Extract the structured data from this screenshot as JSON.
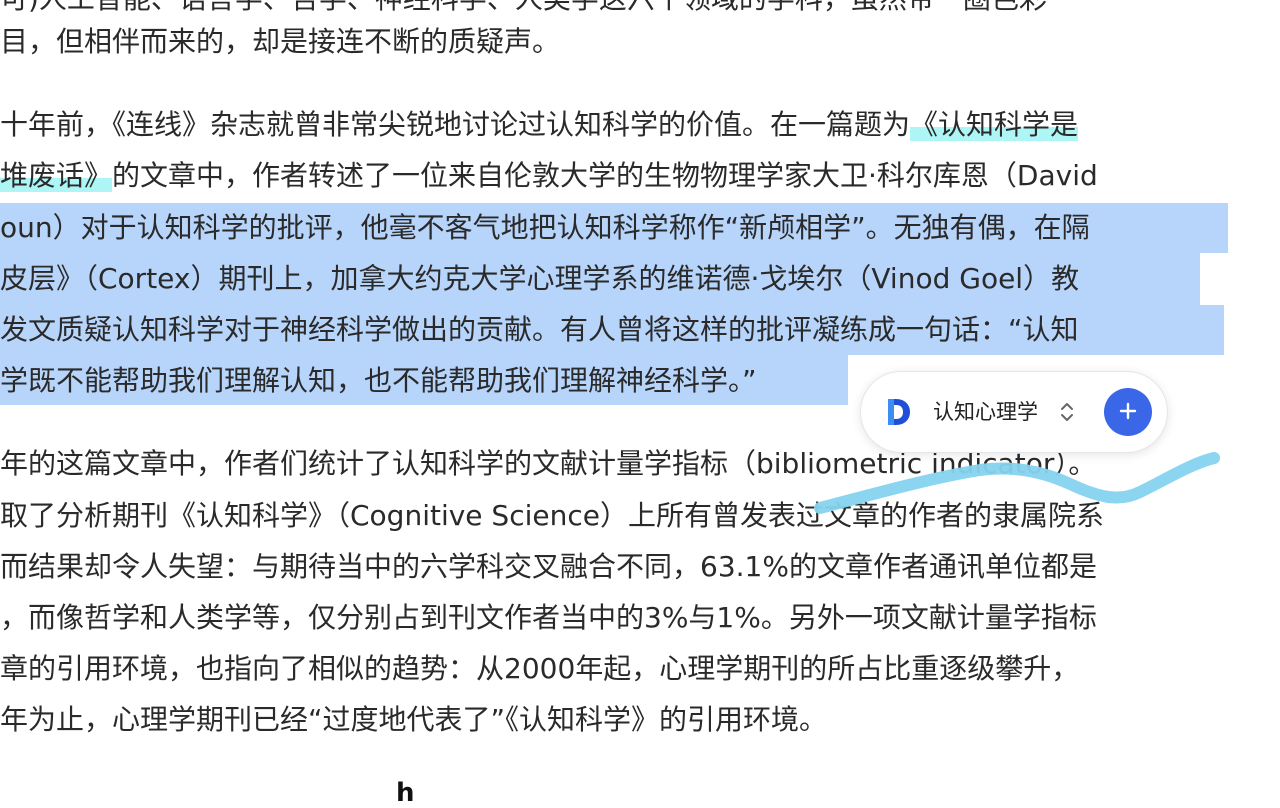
{
  "article": {
    "lines": [
      {
        "parts": [
          {
            "text": "可)人工智能、语言学、哲学、神经科学、人类学这六个领域的学科，虽然带一圈色彩",
            "style": "plain"
          }
        ]
      },
      {
        "parts": [
          {
            "text": "目，但相伴而来的，却是接连不断的质疑声。",
            "style": "plain"
          }
        ]
      },
      {
        "parts": [
          {
            "text": "十年前，《连线》杂志就曾非常尖锐地讨论过认知科学的价值。在一篇题为",
            "style": "plain"
          },
          {
            "text": "《认知科学是",
            "style": "teal"
          }
        ]
      },
      {
        "parts": [
          {
            "text": "堆废话》",
            "style": "teal"
          },
          {
            "text": "的文章中，作者转述了一位来自伦敦大学的生物物理学家大卫·科尔库恩（David",
            "style": "plain"
          }
        ]
      },
      {
        "parts": [
          {
            "text": "oun）对",
            "style": "sel"
          },
          {
            "text": "于认知科学的批评，他毫不客气地把认知科学称作“新颅相学”。无独有偶，在隔",
            "style": "sel"
          }
        ]
      },
      {
        "parts": [
          {
            "text": "皮层》（Cortex）期刊上，加拿大约克大学心理学系的维诺德·戈埃尔（Vinod Goel）教",
            "style": "sel"
          }
        ]
      },
      {
        "parts": [
          {
            "text": "发文质疑认知科学对于神经科学做出的贡献。有人曾将这样的批评凝练成一句话：“认知",
            "style": "sel"
          }
        ]
      },
      {
        "parts": [
          {
            "text": "学既不能帮助我们理解认知，也不能帮助我们理解神经科学。”",
            "style": "sel"
          }
        ]
      },
      {
        "parts": [
          {
            "text": "年的这篇文章中，作者们统计了认知科学的文献计量学指标（bibliometric indicator）。",
            "style": "plain"
          }
        ]
      },
      {
        "parts": [
          {
            "text": "取了分析期刊《认知科学》（Cognitive Science）上所有曾发表过文章的作者的隶属院系",
            "style": "plain"
          }
        ]
      },
      {
        "parts": [
          {
            "text": "而结果却令人失望：与期待当中的六学科交叉融合不同，63.1%的文章作者通讯单位都是",
            "style": "plain"
          }
        ]
      },
      {
        "parts": [
          {
            "text": "，而像哲学和人类学等，仅分别占到刊文作者当中的3%与1%。另外一项文献计量学指标",
            "style": "plain"
          }
        ]
      },
      {
        "parts": [
          {
            "text": "章的引用环境，也指向了相似的趋势：从2000年起，心理学期刊的所占比重逐级攀升，",
            "style": "plain"
          }
        ]
      },
      {
        "parts": [
          {
            "text": "年为止，心理学期刊已经“过度地代表了”《认知科学》的引用环境。",
            "style": "plain"
          }
        ]
      }
    ],
    "partial_glyph": "h"
  },
  "toolbar": {
    "notebook_label": "认知心理学",
    "logo_icon": "app-logo-icon",
    "chevron_icon": "chevron-up-down-icon",
    "add_icon": "plus-icon",
    "accent_color": "#3a67e8"
  },
  "colors": {
    "selection": "#b7d4fb",
    "teal_highlight": "#aef5f5",
    "scribble": "#86d3ef"
  }
}
